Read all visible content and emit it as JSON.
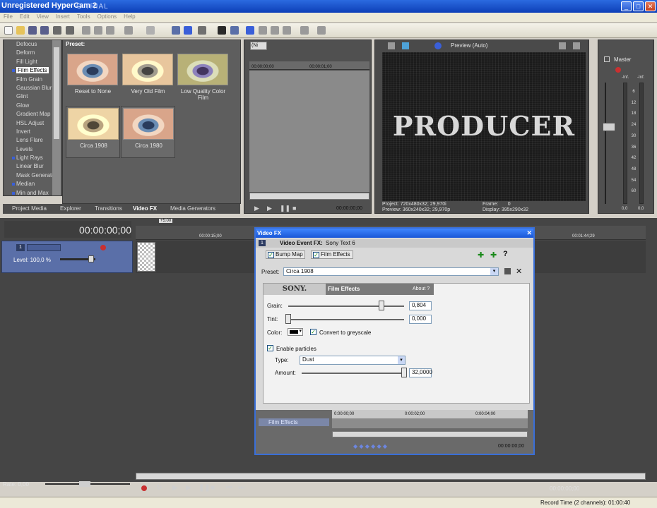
{
  "window": {
    "title": "Unregistered HyperCam 2",
    "title_ghost": "O TRIAL",
    "min": "_",
    "max": "□",
    "close": "✕"
  },
  "menu": [
    "File",
    "Edit",
    "View",
    "Insert",
    "Tools",
    "Options",
    "Help"
  ],
  "fx_list": {
    "items": [
      {
        "label": "Defocus",
        "dot": false,
        "selected": false
      },
      {
        "label": "Deform",
        "dot": false,
        "selected": false
      },
      {
        "label": "Fill Light",
        "dot": false,
        "selected": false
      },
      {
        "label": "Film Effects",
        "dot": true,
        "selected": true
      },
      {
        "label": "Film Grain",
        "dot": false,
        "selected": false
      },
      {
        "label": "Gaussian Blur",
        "dot": false,
        "selected": false
      },
      {
        "label": "Glint",
        "dot": false,
        "selected": false
      },
      {
        "label": "Glow",
        "dot": false,
        "selected": false
      },
      {
        "label": "Gradient Map",
        "dot": false,
        "selected": false
      },
      {
        "label": "HSL Adjust",
        "dot": false,
        "selected": false
      },
      {
        "label": "Invert",
        "dot": false,
        "selected": false
      },
      {
        "label": "Lens Flare",
        "dot": false,
        "selected": false
      },
      {
        "label": "Levels",
        "dot": false,
        "selected": false
      },
      {
        "label": "Light Rays",
        "dot": true,
        "selected": false
      },
      {
        "label": "Linear Blur",
        "dot": false,
        "selected": false
      },
      {
        "label": "Mask Generator",
        "dot": false,
        "selected": false
      },
      {
        "label": "Median",
        "dot": true,
        "selected": false
      },
      {
        "label": "Min and Max",
        "dot": true,
        "selected": false
      }
    ]
  },
  "presets": {
    "heading": "Preset:",
    "items": [
      "Reset to None",
      "Very Old Film",
      "Low Quality Color Film",
      "Circa 1908",
      "Circa 1980"
    ]
  },
  "tabs": [
    {
      "label": "Project Media",
      "active": false
    },
    {
      "label": "Explorer",
      "active": false
    },
    {
      "label": "Transitions",
      "active": false
    },
    {
      "label": "Video FX",
      "active": true
    },
    {
      "label": "Media Generators",
      "active": false
    }
  ],
  "trimmer": {
    "dropdown": "(Ni",
    "time_start": "00:00:00;00",
    "time_mid": "00:00:01;00",
    "timecode": "00:00:00;00"
  },
  "preview": {
    "mode_label": "Preview (Auto)",
    "overlay_text": "PRODUCER",
    "project_label": "Project:",
    "project_value": "720x480x32; 29,970i",
    "preview_label": "Preview:",
    "preview_value": "360x240x32; 29,970p",
    "frame_label": "Frame:",
    "frame_value": "0",
    "display_label": "Display:",
    "display_value": "395x290x32"
  },
  "master": {
    "label": "Master",
    "inf_left": "-Inf.",
    "inf_right": "-Inf.",
    "scale": [
      "6",
      "12",
      "18",
      "24",
      "30",
      "36",
      "42",
      "48",
      "54",
      "60"
    ],
    "bottom_left": "0,0",
    "bottom_right": "0,0"
  },
  "timeline": {
    "timecode": "00:00:00;00",
    "ruler_marker": "+5:00",
    "ruler_15": "00:00:15;00",
    "ruler_end": "00:01:44;29",
    "track_number": "1",
    "level_label": "Level: 100,0 %",
    "rate_label": "Rate: 0,00",
    "transport_time": "00:00:00;00",
    "record_time": "Record Time (2 channels): 01:00:40"
  },
  "dialog": {
    "title": "Video FX",
    "event_prefix": "Video Event FX:",
    "event_name": "Sony Text 6",
    "chain": [
      "Bump Map",
      "Film Effects"
    ],
    "preset_label": "Preset:",
    "preset_value": "Circa 1908",
    "brand": "SONY.",
    "plugin_name": "Film Effects",
    "about": "About  ?",
    "grain_label": "Grain:",
    "grain_value": "0,804",
    "grain_level": 0.804,
    "tint_label": "Tint:",
    "tint_value": "0,000",
    "tint_level": 0,
    "color_label": "Color:",
    "greyscale_label": "Convert to greyscale",
    "greyscale_checked": true,
    "particles_label": "Enable particles",
    "particles_checked": true,
    "type_label": "Type:",
    "type_value": "Dust",
    "amount_label": "Amount:",
    "amount_value": "32,0000",
    "amount_level": 1.0,
    "kf_track_label": "Film Effects",
    "kf_time_0": "0:00:00;00",
    "kf_time_2": "0:00:02;00",
    "kf_time_4": "0:00:04;00",
    "kf_timecode": "00:00:00;00"
  },
  "colors": {
    "title_blue": "#0d3fb7",
    "track_blue": "#5a6fa8",
    "dark_bg": "#454545"
  }
}
